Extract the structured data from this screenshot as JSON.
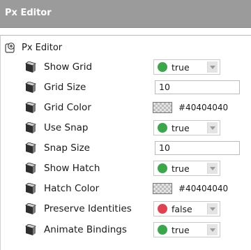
{
  "title": "Px Editor",
  "tree": {
    "root_label": "Px Editor"
  },
  "colors": {
    "true_dot": "#3aa84a",
    "false_dot": "#e0434f"
  },
  "properties": [
    {
      "label": "Show Grid",
      "kind": "bool",
      "value": "true"
    },
    {
      "label": "Grid Size",
      "kind": "text",
      "value": "10"
    },
    {
      "label": "Grid Color",
      "kind": "color",
      "value": "#40404040"
    },
    {
      "label": "Use Snap",
      "kind": "bool",
      "value": "true"
    },
    {
      "label": "Snap Size",
      "kind": "text",
      "value": "10"
    },
    {
      "label": "Show Hatch",
      "kind": "bool",
      "value": "true"
    },
    {
      "label": "Hatch Color",
      "kind": "color",
      "value": "#40404040"
    },
    {
      "label": "Preserve Identities",
      "kind": "bool",
      "value": "false"
    },
    {
      "label": "Animate Bindings",
      "kind": "bool",
      "value": "true"
    }
  ]
}
